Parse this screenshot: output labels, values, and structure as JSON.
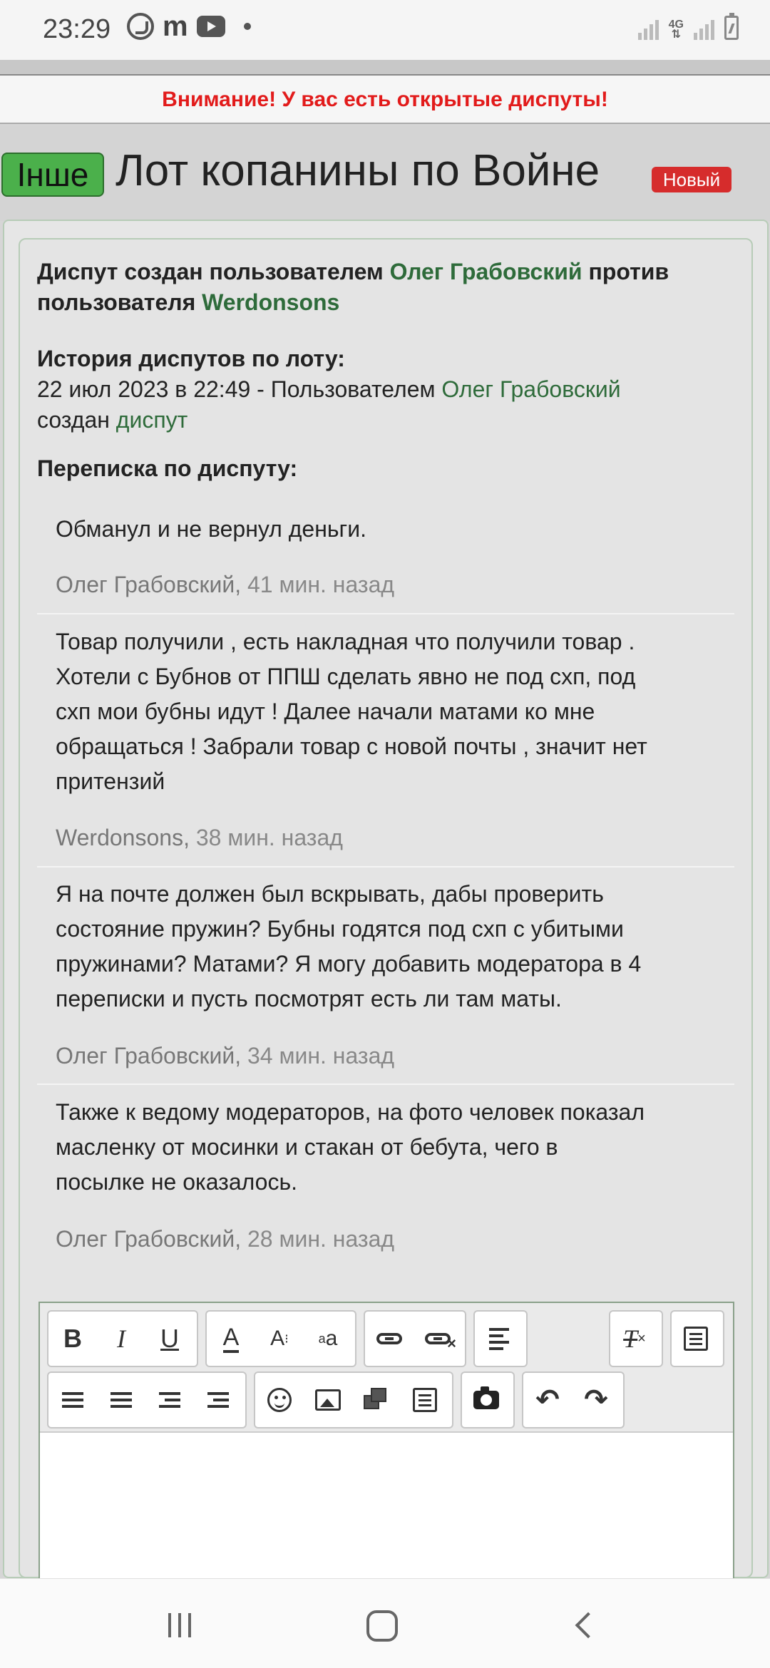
{
  "status_bar": {
    "time": "23:29",
    "notif_m": "m",
    "network_type": "4G",
    "icons": [
      "viber-icon",
      "m-app-icon",
      "youtube-icon",
      "dot-icon",
      "signal-icon",
      "4g-icon",
      "battery-icon"
    ]
  },
  "alert": {
    "text": "Внимание! У вас есть открытые диспуты!",
    "color": "#e21b1b"
  },
  "header": {
    "category_tag": "Інше",
    "lot_title": "Лот копанины по Войне",
    "status_badge": "Новый"
  },
  "dispute": {
    "created_prefix": "Диспут создан пользователем",
    "creator": "Олег Грабовский",
    "against_word": "против",
    "against_prefix": "пользователя",
    "opponent": "Werdonsons",
    "history_title": "История диспутов по лоту:",
    "history_date": "22 июл 2023 в 22:49 - Пользователем",
    "history_user": "Олег Грабовский",
    "history_action": "создан",
    "history_link": "диспут",
    "correspondence_title": "Переписка по диспуту:"
  },
  "messages": [
    {
      "lines": [
        "Обманул и не вернул деньги."
      ],
      "author": "Олег Грабовский,",
      "time": "41 мин. назад"
    },
    {
      "lines": [
        "Товар получили , есть накладная что получили товар .",
        "Хотели с Бубнов от ППШ сделать явно не под схп, под",
        "схп мои бубны идут ! Далее начали матами ко мне",
        "обращаться ! Забрали товар с новой почты , значит нет",
        "притензий"
      ],
      "author": "Werdonsons,",
      "time": "38 мин. назад"
    },
    {
      "lines": [
        "Я на почте должен был вскрывать, дабы проверить",
        "состояние пружин? Бубны годятся под схп с убитыми",
        "пружинами? Матами? Я могу добавить модератора в 4",
        "переписки и пусть посмотрят есть ли там маты."
      ],
      "author": "Олег Грабовский,",
      "time": "34 мин. назад"
    },
    {
      "lines": [
        "Также к ведому модераторов, на фото человек показал",
        "масленку от мосинки и стакан от бебута, чего в",
        "посылке не оказалось."
      ],
      "author": "Олег Грабовский,",
      "time": "28 мин. назад"
    }
  ],
  "editor": {
    "bold_label": "B",
    "italic_label": "I",
    "underline_label": "U",
    "font_color_label": "A",
    "font_size_label": "A",
    "font_size_sub": "a",
    "clear_format_label": "T",
    "icons": [
      "bold-icon",
      "italic-icon",
      "underline-icon",
      "font-color-icon",
      "font-size-icon",
      "font-case-icon",
      "link-icon",
      "unlink-icon",
      "align-icon",
      "clear-format-icon",
      "paste-icon",
      "bullet-list-icon",
      "numbered-list-icon",
      "outdent-icon",
      "indent-icon",
      "emoji-icon",
      "image-icon",
      "gallery-icon",
      "template-icon",
      "camera-icon",
      "undo-icon",
      "redo-icon"
    ]
  },
  "colors": {
    "link_green": "#2e6b3a",
    "tag_green": "#4bb04b",
    "badge_red": "#d62c2c",
    "meta_gray": "#888888"
  }
}
